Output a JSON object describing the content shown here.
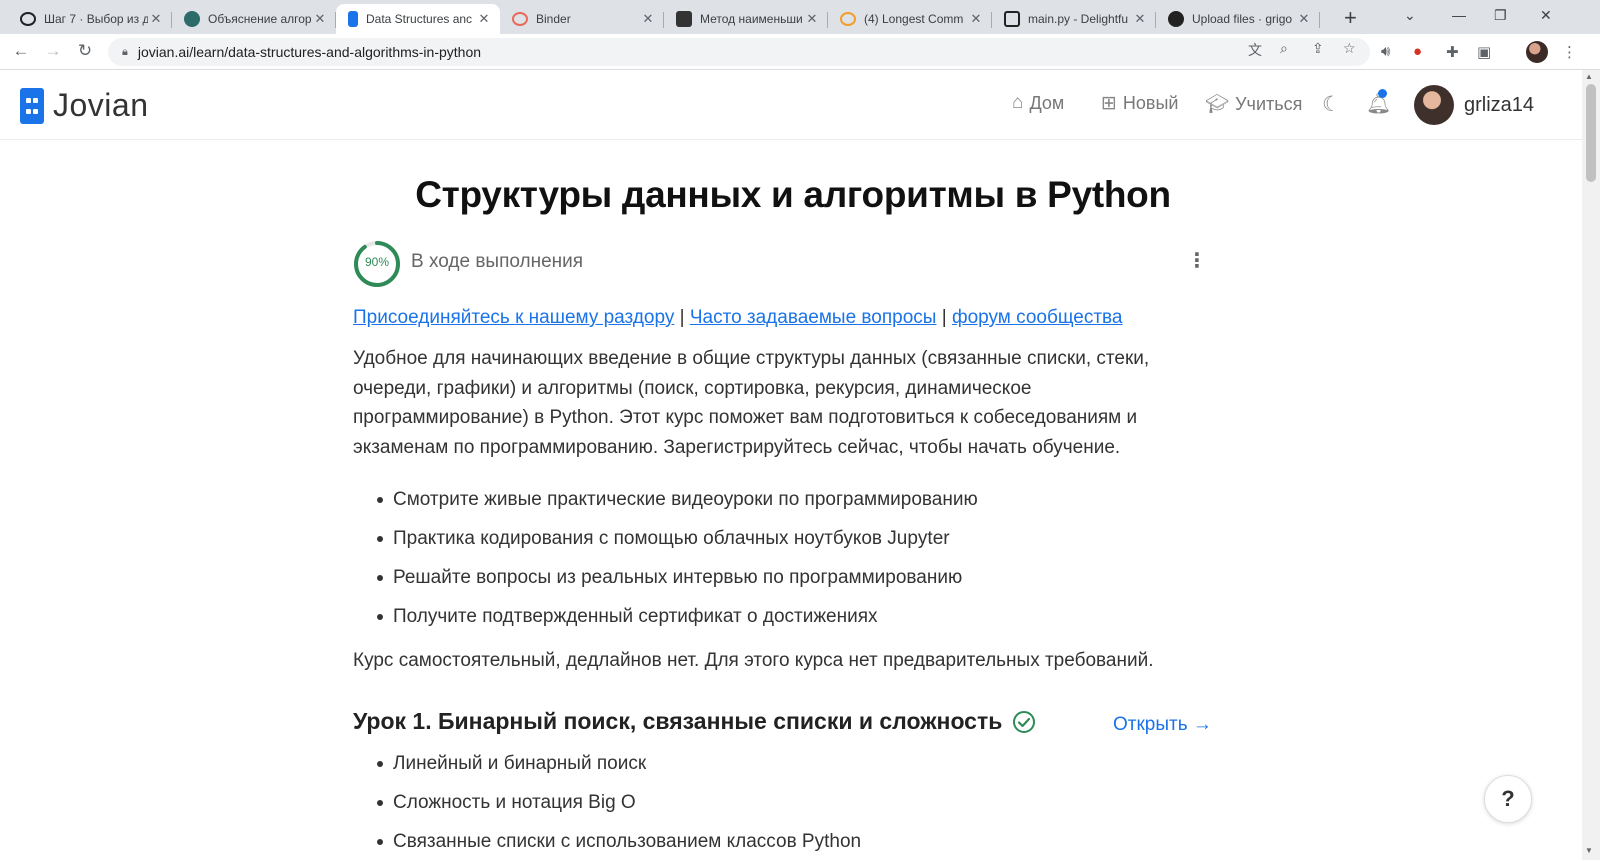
{
  "browser": {
    "tabs": [
      {
        "title": "Шаг 7 · Выбор из д",
        "icon": "stepik-icon"
      },
      {
        "title": "Объяснение алгор",
        "icon": "site-icon"
      },
      {
        "title": "Data Structures anc",
        "icon": "jovian-icon",
        "active": true
      },
      {
        "title": "Binder",
        "icon": "binder-icon"
      },
      {
        "title": "Метод наименьши",
        "icon": "site-icon"
      },
      {
        "title": "(4) Longest Comm",
        "icon": "site-icon"
      },
      {
        "title": "main.py - Delightfu",
        "icon": "replit-icon"
      },
      {
        "title": "Upload files · grigo",
        "icon": "github-icon"
      }
    ],
    "url": "jovian.ai/learn/data-structures-and-algorithms-in-python",
    "ext_badge": "1"
  },
  "header": {
    "logo_text": "Jovian",
    "nav": {
      "home": "Дом",
      "new": "Новый",
      "learn": "Учиться"
    },
    "username": "grliza14"
  },
  "course": {
    "title": "Структуры данных и алгоритмы в Python",
    "progress_percent": 90,
    "progress_label": "90%",
    "status": "В ходе выполнения",
    "links": {
      "discord": "Присоединяйтесь к нашему раздору",
      "sep": "|",
      "faq": "Часто задаваемые вопросы",
      "forum": "форум сообщества"
    },
    "description": "Удобное для начинающих введение в общие структуры данных (связанные списки, стеки, очереди, графики) и алгоритмы (поиск, сортировка, рекурсия, динамическое программирование) в Python. Этот курс поможет вам подготовиться к собеседованиям и экзаменам по программированию. Зарегистрируйтесь сейчас, чтобы начать обучение.",
    "features": [
      "Смотрите живые практические видеоуроки по программированию",
      "Практика кодирования с помощью облачных ноутбуков Jupyter",
      "Решайте вопросы из реальных интервью по программированию",
      "Получите подтвержденный сертификат о достижениях"
    ],
    "note": "Курс самостоятельный, дедлайнов нет. Для этого курса нет предварительных требований.",
    "lesson1": {
      "title": "Урок 1. Бинарный поиск, связанные списки и сложность",
      "open": "Открыть →",
      "topics": [
        "Линейный и бинарный поиск",
        "Сложность и нотация Big O",
        "Связанные списки с использованием классов Python"
      ]
    }
  },
  "help_label": "?",
  "colors": {
    "accent": "#1a73e8",
    "progress": "#2e8b57"
  }
}
